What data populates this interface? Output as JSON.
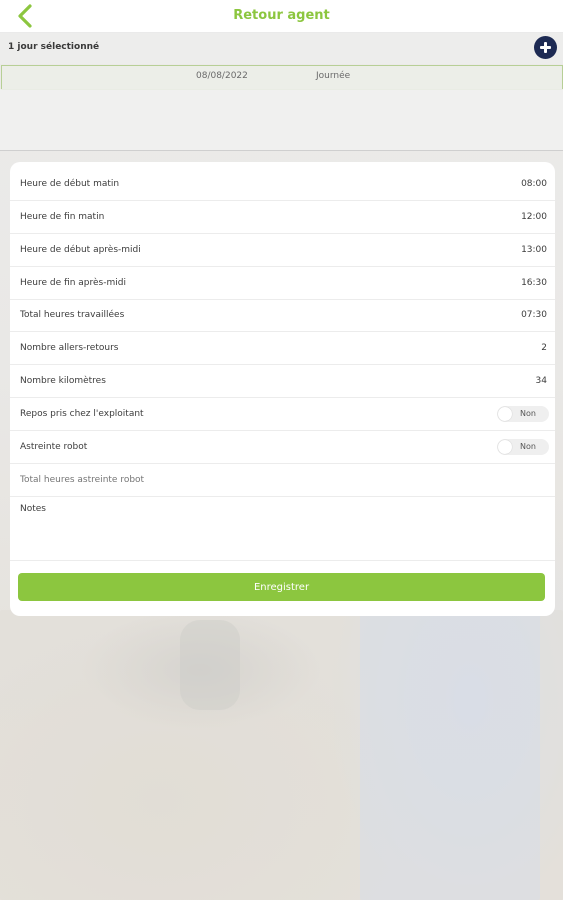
{
  "colors": {
    "accent": "#8cc63f",
    "add_button": "#1d2a53"
  },
  "header": {
    "title": "Retour agent",
    "back_icon": "chevron-left-icon"
  },
  "selection": {
    "summary": "1 jour sélectionné",
    "add_icon": "plus-circle-icon"
  },
  "days": [
    {
      "date": "08/08/2022",
      "type": "Journée"
    }
  ],
  "form": {
    "start_morning": {
      "label": "Heure de début matin",
      "value": "08:00"
    },
    "end_morning": {
      "label": "Heure de fin matin",
      "value": "12:00"
    },
    "start_afternoon": {
      "label": "Heure de début après-midi",
      "value": "13:00"
    },
    "end_afternoon": {
      "label": "Heure de fin après-midi",
      "value": "16:30"
    },
    "total_hours": {
      "label": "Total heures travaillées",
      "value": "07:30"
    },
    "round_trips": {
      "label": "Nombre allers-retours",
      "value": "2"
    },
    "kilometers": {
      "label": "Nombre kilomètres",
      "value": "34"
    },
    "rest_at_farmer": {
      "label": "Repos pris chez l'exploitant",
      "toggle": "Non"
    },
    "robot_duty": {
      "label": "Astreinte robot",
      "toggle": "Non"
    },
    "robot_duty_hours": {
      "placeholder": "Total heures astreinte robot"
    },
    "notes": {
      "label": "Notes"
    },
    "save_label": "Enregistrer"
  }
}
